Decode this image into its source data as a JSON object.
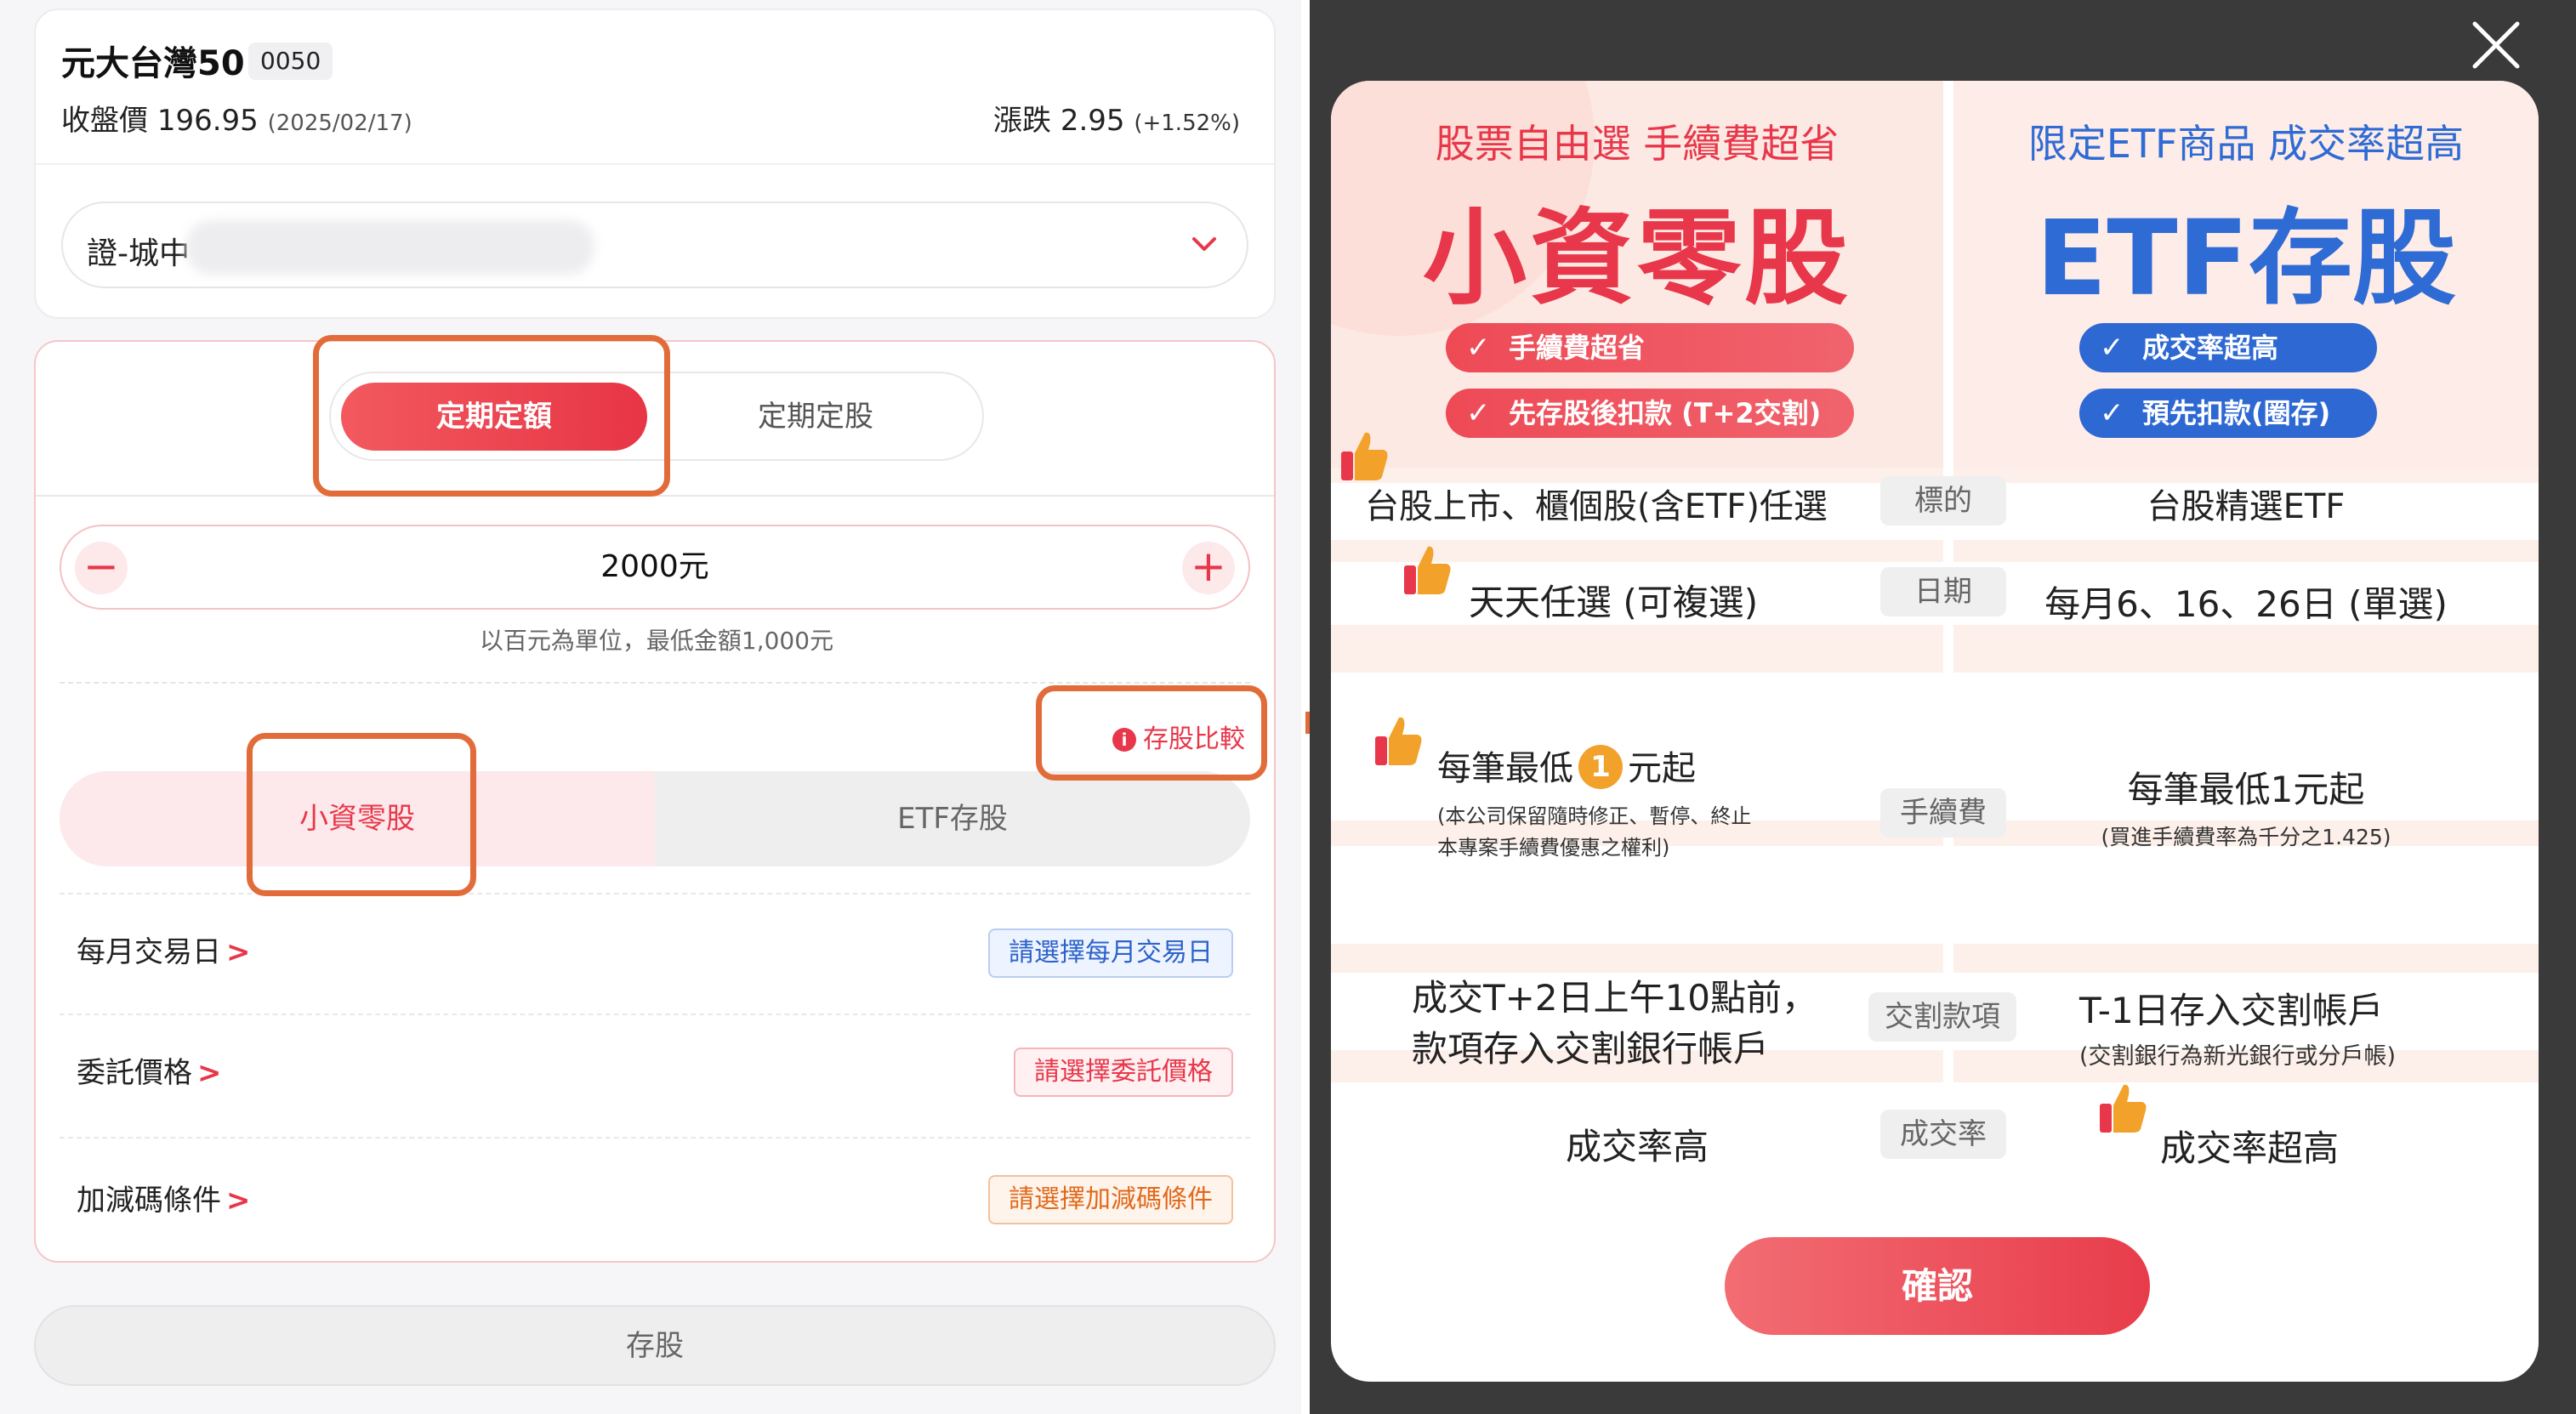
{
  "left_panel": {
    "stock": {
      "name": "元大台灣50",
      "code": "0050",
      "close_label": "收盤價",
      "close_price": "196.95",
      "close_date": "(2025/02/17)",
      "change_label": "漲跌",
      "change_value": "2.95",
      "change_pct": "(+1.52%)"
    },
    "branch": {
      "value": "證-城中"
    },
    "plan_mode": {
      "active": "定期定額",
      "inactive": "定期定股"
    },
    "amount": {
      "value": "2000元",
      "hint": "以百元為單位，最低金額1,000元",
      "minus": "−",
      "plus": "+"
    },
    "compare_link": "存股比較",
    "stock_type": {
      "active": "小資零股",
      "inactive": "ETF存股"
    },
    "rows": [
      {
        "label": "每月交易日",
        "chevron": ">",
        "tag": "請選擇每月交易日"
      },
      {
        "label": "委託價格",
        "chevron": ">",
        "tag": "請選擇委託價格"
      },
      {
        "label": "加減碼條件",
        "chevron": ">",
        "tag": "請選擇加減碼條件"
      }
    ],
    "submit": "存股"
  },
  "modal": {
    "left_col": {
      "subtitle": "股票自由選 手續費超省",
      "title": "小資零股",
      "pills": [
        "手續費超省",
        "先存股後扣款 (T+2交割)"
      ]
    },
    "right_col": {
      "subtitle": "限定ETF商品 成交率超高",
      "title": "ETF存股",
      "pills": [
        "成交率超高",
        "預先扣款(圈存)"
      ]
    },
    "rows": {
      "target": {
        "category": "標的",
        "left": "台股上市、櫃個股(含ETF)任選",
        "right": "台股精選ETF"
      },
      "date": {
        "category": "日期",
        "left": "天天任選 (可複選)",
        "right": "每月6、16、26日 (單選)"
      },
      "fee": {
        "category": "手續費",
        "left_prefix": "每筆最低",
        "left_number": "1",
        "left_suffix": "元起",
        "left_note_1": "(本公司保留隨時修正、暫停、終止",
        "left_note_2": "本專案手續費優惠之權利)",
        "right": "每筆最低1元起",
        "right_note": "(買進手續費率為千分之1.425)"
      },
      "settlement": {
        "category": "交割款項",
        "left_1": "成交T+2日上午10點前，",
        "left_2": "款項存入交割銀行帳戶",
        "right": "T-1日存入交割帳戶",
        "right_note": "(交割銀行為新光銀行或分戶帳)"
      },
      "fill_rate": {
        "category": "成交率",
        "left": "成交率高",
        "right": "成交率超高"
      }
    },
    "confirm": "確認",
    "close_icon": "close-icon"
  },
  "colors": {
    "accent_red": "#e8374a",
    "accent_blue": "#2f6bd4",
    "highlight": "#e26b3a",
    "thumb": "#f2a12a"
  }
}
